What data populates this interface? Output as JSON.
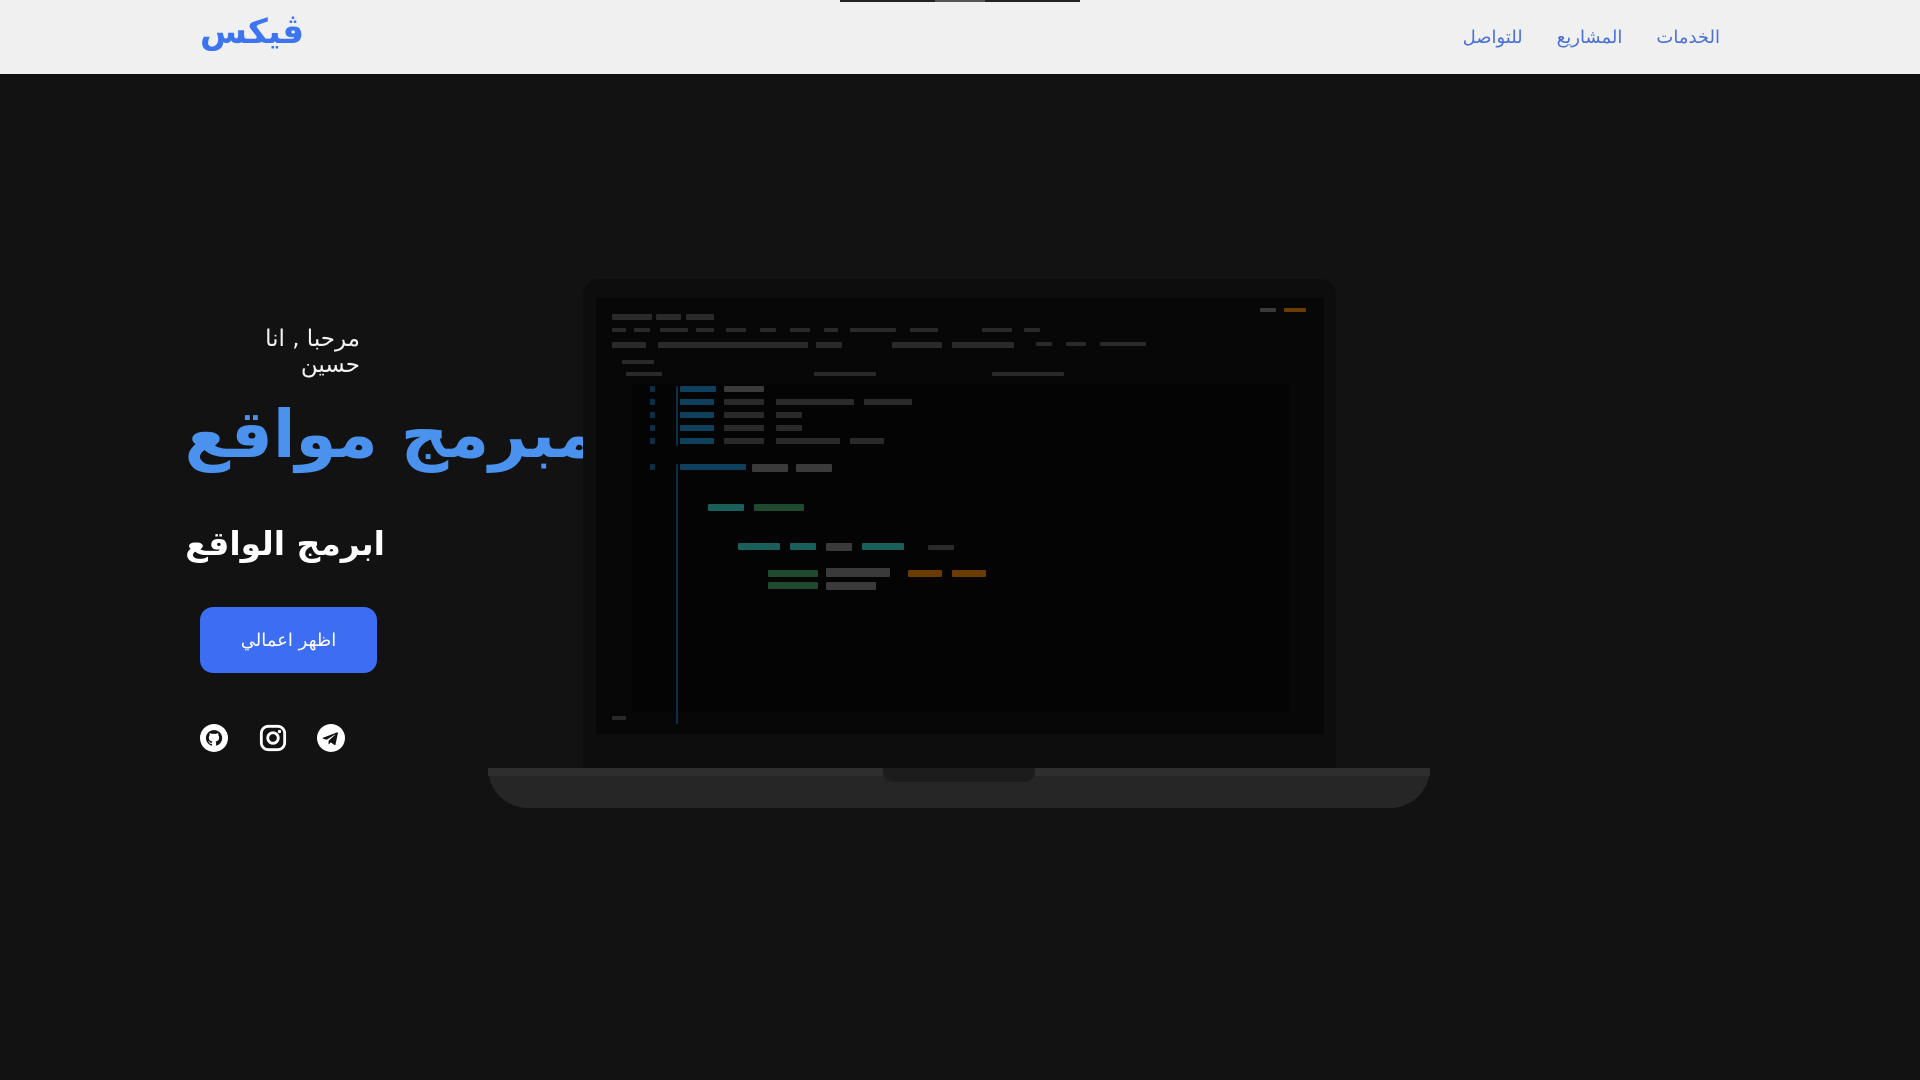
{
  "nav": {
    "logo": "ڤيكس",
    "links": [
      "الخدمات",
      "المشاريع",
      "للتواصل"
    ]
  },
  "hero": {
    "greeting": "مرحبا , انا حسين",
    "title": "مبرمج مواقع",
    "subtitle": "ابرمج الواقع",
    "cta_label": "اظهر اعمالي"
  },
  "social": {
    "icons": [
      "github-icon",
      "instagram-icon",
      "telegram-icon"
    ]
  },
  "colors": {
    "accent": "#3d6df2",
    "title": "#4a92ee",
    "nav_bg": "#f0f0f0",
    "page_bg": "#121212"
  }
}
